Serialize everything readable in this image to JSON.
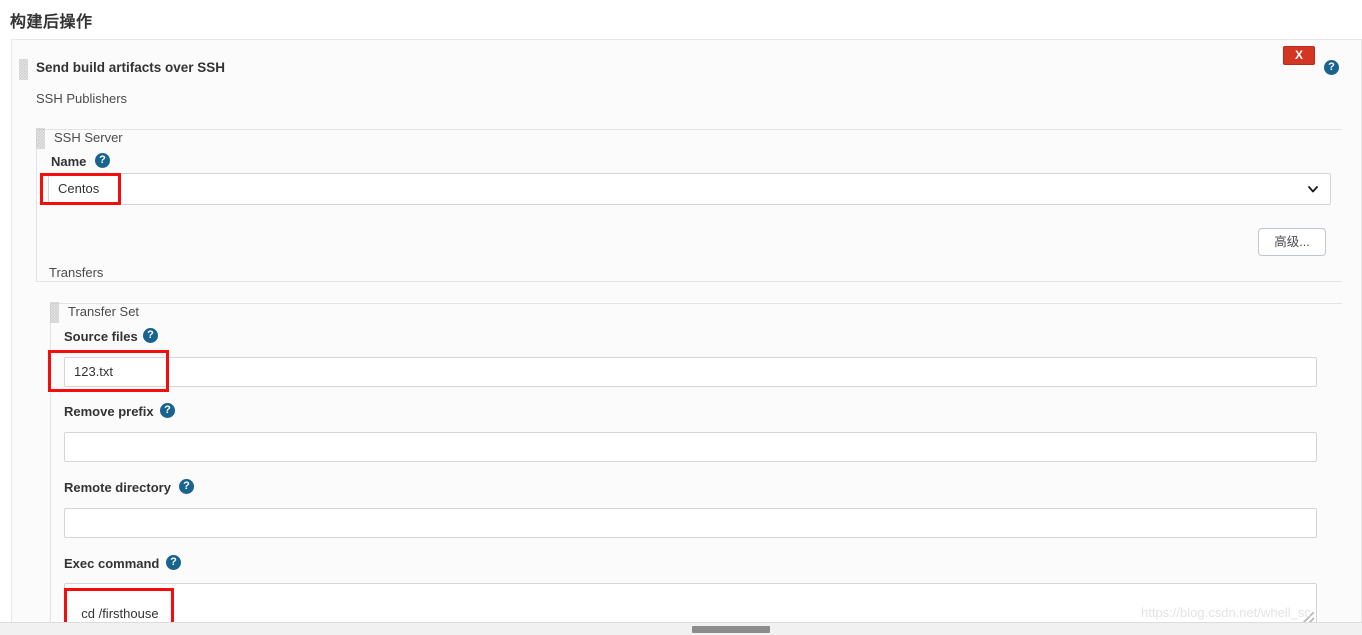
{
  "page": {
    "title": "构建后操作"
  },
  "publisher": {
    "name": "Send build artifacts over SSH",
    "section_label": "SSH Publishers",
    "delete_label": "X",
    "help_icon": "help-circle-icon",
    "grip_icon": "drag-grip-icon"
  },
  "ssh_server": {
    "legend": "SSH Server",
    "name_label": "Name",
    "name_help": "?",
    "name_value": "Centos",
    "name_options": [
      "Centos"
    ],
    "chevron_icon": "chevron-down-icon",
    "advanced_button": "高级..."
  },
  "transfers": {
    "legend": "Transfers",
    "set_legend": "Transfer Set",
    "fields": [
      {
        "label": "Source files",
        "help": "?",
        "value": "123.txt",
        "placeholder": "",
        "type": "text"
      },
      {
        "label": "Remove prefix",
        "help": "?",
        "value": "",
        "placeholder": "",
        "type": "text"
      },
      {
        "label": "Remote directory",
        "help": "?",
        "value": "",
        "placeholder": "",
        "type": "text"
      },
      {
        "label": "Exec command",
        "help": "?",
        "value": "cd /firsthouse\n/usr/bin/git pull",
        "placeholder": "",
        "type": "textarea"
      }
    ]
  },
  "annotations": {
    "color": "#f50d0d",
    "boxes": [
      "name-select",
      "source-files-input",
      "exec-command-textarea"
    ]
  },
  "watermark": {
    "text": "https://blog.csdn.net/whell_sc"
  },
  "colors": {
    "help_blue": "#19638f",
    "delete_red": "#d33724",
    "annotation_red": "#f50d0d"
  }
}
